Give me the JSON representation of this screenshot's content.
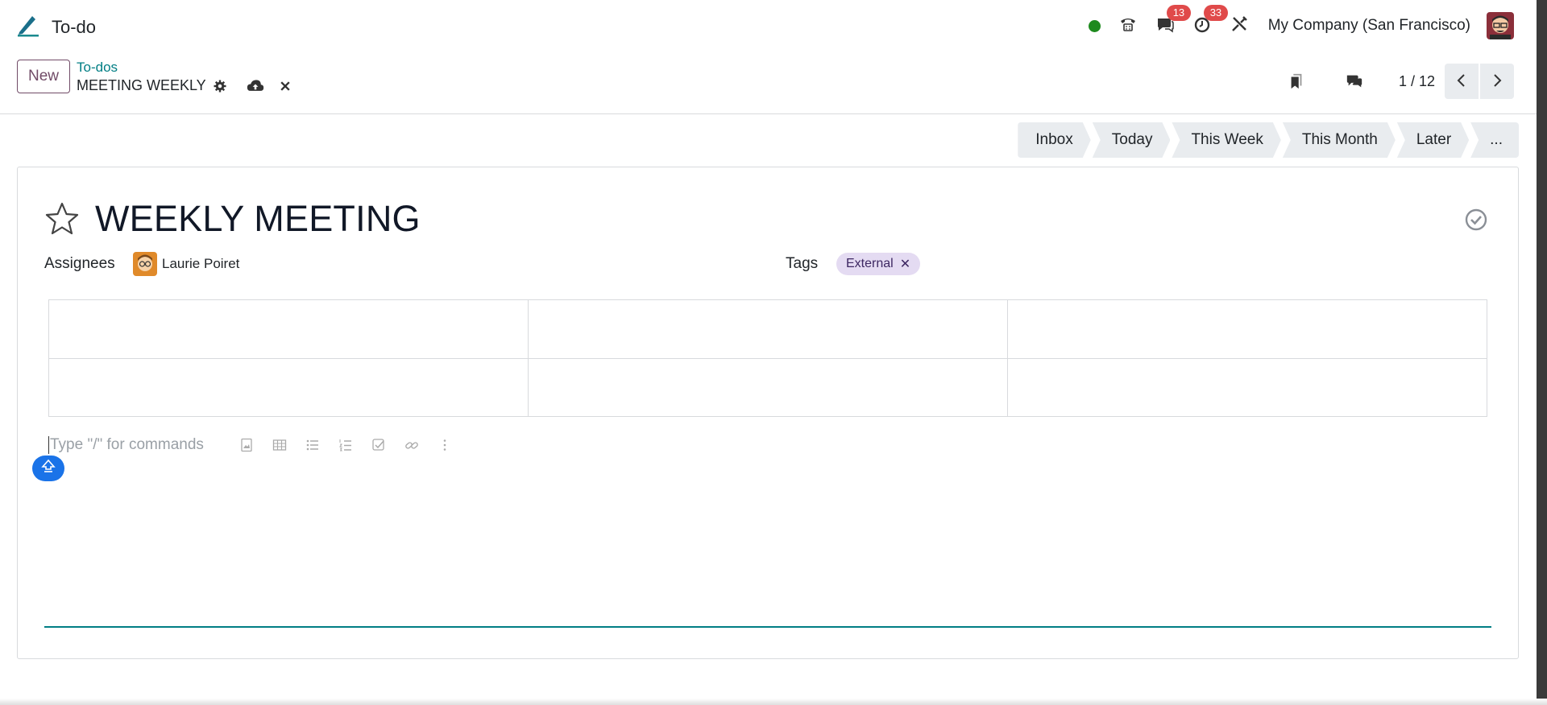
{
  "navbar": {
    "app_title": "To-do",
    "badges": {
      "messages": "13",
      "activities": "33"
    },
    "company": "My Company (San Francisco)"
  },
  "control_panel": {
    "new_label": "New",
    "breadcrumb_parent": "To-dos",
    "record_name": "MEETING WEEKLY",
    "pager": "1 / 12"
  },
  "stages": [
    "Inbox",
    "Today",
    "This Week",
    "This Month",
    "Later",
    "..."
  ],
  "form": {
    "title": "WEEKLY MEETING",
    "assignees_label": "Assignees",
    "assignee_name": "Laurie Poiret",
    "tags_label": "Tags",
    "tag": "External",
    "tag_remove": "✕",
    "editor_placeholder": "Type \"/\" for commands"
  },
  "colors": {
    "primary": "#714b67",
    "link": "#017e84",
    "badge": "#e04a4a",
    "presence": "#1e8a1e",
    "tag_bg": "#e4dbf2",
    "fab": "#1a73e8"
  },
  "icons": [
    "pencil-logo-icon",
    "presence-dot",
    "phone-icon",
    "chat-icon",
    "clock-icon",
    "tools-icon",
    "gear-icon",
    "cloud-upload-icon",
    "close-icon",
    "bookmark-icon",
    "comments-icon",
    "chevron-left-icon",
    "chevron-right-icon",
    "star-icon",
    "check-circle-icon",
    "image-icon",
    "table-icon",
    "bullet-list-icon",
    "numbered-list-icon",
    "checklist-icon",
    "link-icon",
    "more-vertical-icon"
  ]
}
